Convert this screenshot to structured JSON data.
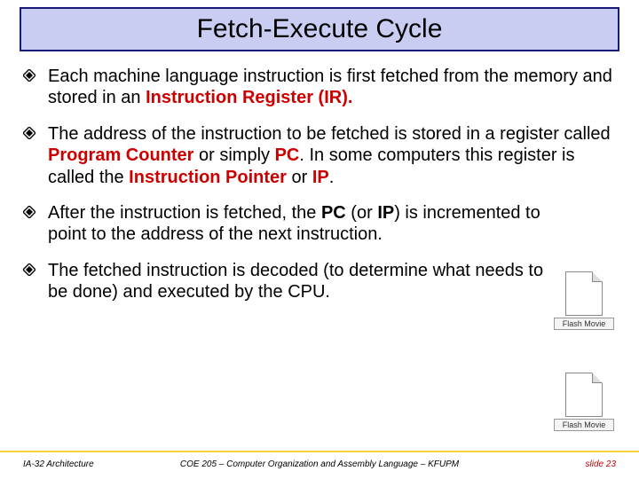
{
  "title": "Fetch-Execute Cycle",
  "bullets": {
    "b1": {
      "t1": "Each machine language instruction is first fetched from the memory and stored in an ",
      "k1": "Instruction Register",
      "t2": "  (IR)."
    },
    "b2": {
      "t1": "The address of the instruction to be fetched is stored in a register called ",
      "k1": "Program Counter",
      "t2": "  or simply ",
      "k2": "PC",
      "t3": ". In some computers this register is called the ",
      "k3": "Instruction Pointer",
      "t4": " or ",
      "k4": "IP",
      "t5": "."
    },
    "b3": {
      "t1": "After the instruction is fetched, the ",
      "k1": "PC",
      "t2": " (or ",
      "k2": "IP",
      "t3": ") is incremented to point to the address of the next instruction."
    },
    "b4": {
      "t1": "The fetched instruction is decoded (to determine what needs to be done) and executed by the CPU."
    }
  },
  "flash_label": "Flash Movie",
  "footer": {
    "left": "IA-32 Architecture",
    "center": "COE 205 – Computer Organization and Assembly Language – KFUPM",
    "right": "slide 23"
  }
}
